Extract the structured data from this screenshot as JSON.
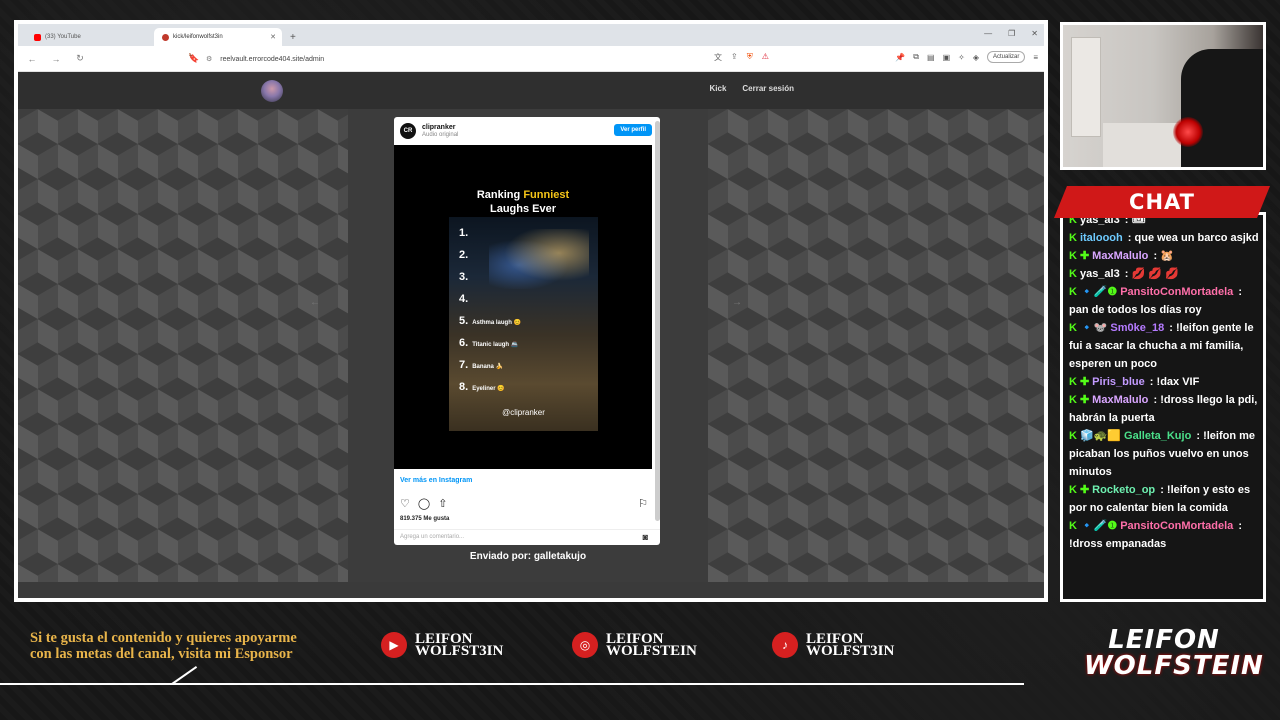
{
  "browser": {
    "tabs": [
      {
        "label": "(33) YouTube",
        "active": false,
        "favicon_color": "#ff0000"
      },
      {
        "label": "kick/leifonwolfst3in",
        "active": true,
        "favicon_color": "#c0392b"
      }
    ],
    "new_tab": "+",
    "window_controls": [
      "—",
      "❐",
      "✕"
    ],
    "url": "reelvault.errorcode404.site/admin",
    "update_label": "Actualizar"
  },
  "site": {
    "nav": [
      "Kick",
      "Cerrar sesión"
    ],
    "sent_by": "Enviado por: galletakujo"
  },
  "instagram": {
    "avatar_text": "CR",
    "username": "clipranker",
    "subtitle": "Audio original",
    "follow_label": "Ver perfil",
    "video_title_1": "Ranking",
    "video_title_hl": "Funniest",
    "video_title_2": "Laughs Ever",
    "ranks": [
      {
        "num": "1.",
        "label": ""
      },
      {
        "num": "2.",
        "label": ""
      },
      {
        "num": "3.",
        "label": ""
      },
      {
        "num": "4.",
        "label": ""
      },
      {
        "num": "5.",
        "label": "Asthma laugh 😊"
      },
      {
        "num": "6.",
        "label": "Titanic laugh 🚢"
      },
      {
        "num": "7.",
        "label": "Banana 🍌"
      },
      {
        "num": "8.",
        "label": "Eyeliner 😊"
      }
    ],
    "handle": "@clipranker",
    "more_label": "Ver más en Instagram",
    "likes": "819.375 Me gusta",
    "comment_placeholder": "Agrega un comentario..."
  },
  "chat": {
    "title": "CHAT",
    "messages": [
      {
        "badges": "",
        "user": "yas_al3",
        "color": "#ffffff",
        "text": "🎟"
      },
      {
        "badges": "",
        "user": "italoooh",
        "color": "#6ecbff",
        "text": "que wea un barco asjkd"
      },
      {
        "badges": "✚",
        "user": "MaxMalulo",
        "color": "#d9a6ff",
        "text": "🐹"
      },
      {
        "badges": "",
        "user": "yas_al3",
        "color": "#ffffff",
        "text": "💋 💋 💋"
      },
      {
        "badges": "🔹🧪❶",
        "user": "PansitoConMortadela",
        "color": "#ff6fa9",
        "text": "pan de todos los días roy"
      },
      {
        "badges": "🔹🐭",
        "user": "Sm0ke_18",
        "color": "#b57bff",
        "text": "!leifon gente le fui a sacar la chucha a mi familia, esperen un poco"
      },
      {
        "badges": "✚",
        "user": "Piris_blue",
        "color": "#c39bff",
        "text": "!dax VIF"
      },
      {
        "badges": "✚",
        "user": "MaxMalulo",
        "color": "#d9a6ff",
        "text": "!dross llego la pdi, habrán la puerta"
      },
      {
        "badges": "🧊🐢🟨",
        "user": "Galleta_Kujo",
        "color": "#4be08a",
        "text": "!leifon me picaban los puños vuelvo en unos minutos"
      },
      {
        "badges": "✚",
        "user": "Rocketo_op",
        "color": "#6ef0b0",
        "text": "!leifon y esto es por no calentar bien la comida"
      },
      {
        "badges": "🔹🧪❶",
        "user": "PansitoConMortadela",
        "color": "#ff6fa9",
        "text": "!dross empanadas"
      }
    ]
  },
  "footer": {
    "sponsor_text": "Si te gusta el contenido y quieres apoyarme con las metas del canal, visita mi Esponsor",
    "socials": [
      {
        "icon": "youtube-icon",
        "glyph": "▶",
        "line1": "LEIFON",
        "line2": "WOLFST3IN"
      },
      {
        "icon": "instagram-icon",
        "glyph": "◎",
        "line1": "LEIFON",
        "line2": "WOLFSTEIN"
      },
      {
        "icon": "tiktok-icon",
        "glyph": "♪",
        "line1": "LEIFON",
        "line2": "WOLFST3IN"
      }
    ],
    "brand_1": "LEIFON",
    "brand_2": "WOLFSTEIN"
  },
  "colors": {
    "kick_green": "#53fc18",
    "chat_red": "#d01818",
    "footer_gold": "#e8b44a",
    "instagram_blue": "#0095f6"
  }
}
